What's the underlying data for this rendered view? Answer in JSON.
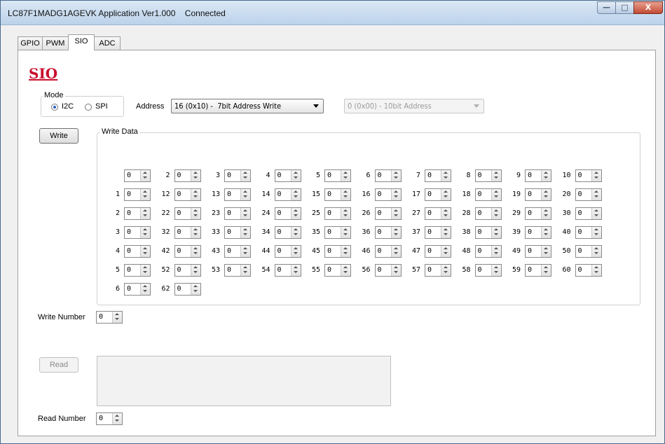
{
  "window": {
    "title": "LC87F1MADG1AGEVK Application Ver1.000    Connected",
    "controls": {
      "minimize": "—",
      "maximize": "□",
      "close": "X"
    }
  },
  "tabs": [
    {
      "label": "GPIO",
      "active": false
    },
    {
      "label": "PWM",
      "active": false
    },
    {
      "label": "SIO",
      "active": true
    },
    {
      "label": "ADC",
      "active": false
    }
  ],
  "heading": "SIO",
  "mode": {
    "group_label": "Mode",
    "options": [
      {
        "label": "I2C",
        "selected": true
      },
      {
        "label": "SPI",
        "selected": false
      }
    ]
  },
  "address": {
    "label": "Address",
    "value": "16 (0x10) -  7bit Address Write",
    "secondary_value": "0 (0x00) - 10bit Address"
  },
  "write": {
    "button_label": "Write",
    "group_label": "Write Data",
    "fields": [
      {
        "label": "",
        "value": "0"
      },
      {
        "label": "2",
        "value": "0"
      },
      {
        "label": "3",
        "value": "0"
      },
      {
        "label": "4",
        "value": "0"
      },
      {
        "label": "5",
        "value": "0"
      },
      {
        "label": "6",
        "value": "0"
      },
      {
        "label": "7",
        "value": "0"
      },
      {
        "label": "8",
        "value": "0"
      },
      {
        "label": "9",
        "value": "0"
      },
      {
        "label": "10",
        "value": "0"
      },
      {
        "label": "1",
        "value": "0"
      },
      {
        "label": "12",
        "value": "0"
      },
      {
        "label": "13",
        "value": "0"
      },
      {
        "label": "14",
        "value": "0"
      },
      {
        "label": "15",
        "value": "0"
      },
      {
        "label": "16",
        "value": "0"
      },
      {
        "label": "17",
        "value": "0"
      },
      {
        "label": "18",
        "value": "0"
      },
      {
        "label": "19",
        "value": "0"
      },
      {
        "label": "20",
        "value": "0"
      },
      {
        "label": "2",
        "value": "0"
      },
      {
        "label": "22",
        "value": "0"
      },
      {
        "label": "23",
        "value": "0"
      },
      {
        "label": "24",
        "value": "0"
      },
      {
        "label": "25",
        "value": "0"
      },
      {
        "label": "26",
        "value": "0"
      },
      {
        "label": "27",
        "value": "0"
      },
      {
        "label": "28",
        "value": "0"
      },
      {
        "label": "29",
        "value": "0"
      },
      {
        "label": "30",
        "value": "0"
      },
      {
        "label": "3",
        "value": "0"
      },
      {
        "label": "32",
        "value": "0"
      },
      {
        "label": "33",
        "value": "0"
      },
      {
        "label": "34",
        "value": "0"
      },
      {
        "label": "35",
        "value": "0"
      },
      {
        "label": "36",
        "value": "0"
      },
      {
        "label": "37",
        "value": "0"
      },
      {
        "label": "38",
        "value": "0"
      },
      {
        "label": "39",
        "value": "0"
      },
      {
        "label": "40",
        "value": "0"
      },
      {
        "label": "4",
        "value": "0"
      },
      {
        "label": "42",
        "value": "0"
      },
      {
        "label": "43",
        "value": "0"
      },
      {
        "label": "44",
        "value": "0"
      },
      {
        "label": "45",
        "value": "0"
      },
      {
        "label": "46",
        "value": "0"
      },
      {
        "label": "47",
        "value": "0"
      },
      {
        "label": "48",
        "value": "0"
      },
      {
        "label": "49",
        "value": "0"
      },
      {
        "label": "50",
        "value": "0"
      },
      {
        "label": "5",
        "value": "0"
      },
      {
        "label": "52",
        "value": "0"
      },
      {
        "label": "53",
        "value": "0"
      },
      {
        "label": "54",
        "value": "0"
      },
      {
        "label": "55",
        "value": "0"
      },
      {
        "label": "56",
        "value": "0"
      },
      {
        "label": "57",
        "value": "0"
      },
      {
        "label": "58",
        "value": "0"
      },
      {
        "label": "59",
        "value": "0"
      },
      {
        "label": "60",
        "value": "0"
      },
      {
        "label": "6",
        "value": "0"
      },
      {
        "label": "62",
        "value": "0"
      }
    ],
    "number_label": "Write Number",
    "number_value": "0"
  },
  "read": {
    "button_label": "Read",
    "number_label": "Read Number",
    "number_value": "0"
  }
}
